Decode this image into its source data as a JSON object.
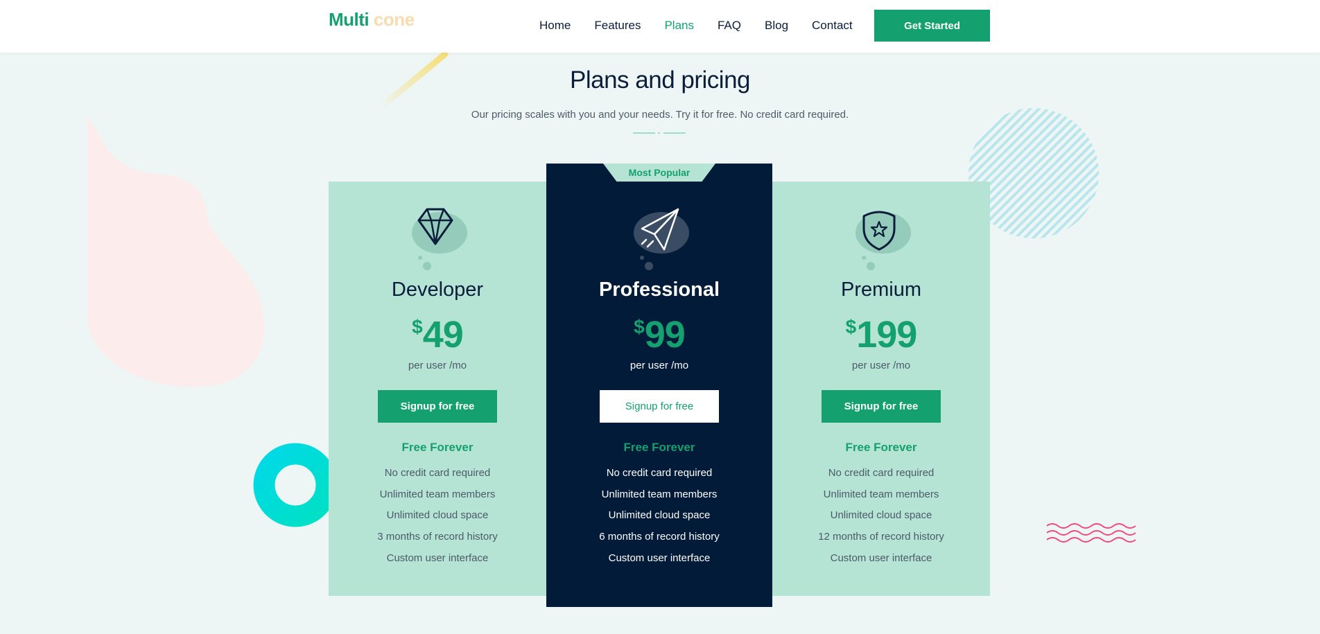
{
  "header": {
    "logo_part1": "Multi",
    "logo_part2": "cone",
    "nav": [
      "Home",
      "Features",
      "Plans",
      "FAQ",
      "Blog",
      "Contact"
    ],
    "active_nav": "Plans",
    "cta_label": "Get Started"
  },
  "section": {
    "title": "Plans and pricing",
    "subtitle": "Our pricing scales with you and your needs. Try it for free. No credit card required."
  },
  "plans": [
    {
      "name": "Developer",
      "icon": "diamond-icon",
      "currency": "$",
      "price": "49",
      "period": "per user /mo",
      "button": "Signup for free",
      "free_label": "Free Forever",
      "features": [
        "No credit card required",
        "Unlimited team members",
        "Unlimited cloud space",
        "3 months of record history",
        "Custom user interface"
      ]
    },
    {
      "name": "Professional",
      "icon": "paper-plane-icon",
      "badge": "Most Popular",
      "currency": "$",
      "price": "99",
      "period": "per user /mo",
      "button": "Signup for free",
      "free_label": "Free Forever",
      "features": [
        "No credit card required",
        "Unlimited team members",
        "Unlimited cloud space",
        "6 months of record history",
        "Custom user interface"
      ]
    },
    {
      "name": "Premium",
      "icon": "star-shield-icon",
      "currency": "$",
      "price": "199",
      "period": "per user /mo",
      "button": "Signup for free",
      "free_label": "Free Forever",
      "features": [
        "No credit card required",
        "Unlimited team members",
        "Unlimited cloud space",
        "12 months of record history",
        "Custom user interface"
      ]
    }
  ],
  "colors": {
    "accent": "#14a06f",
    "dark_card": "#021b39",
    "light_card": "#b5e4d4",
    "background": "#eef6f5"
  }
}
